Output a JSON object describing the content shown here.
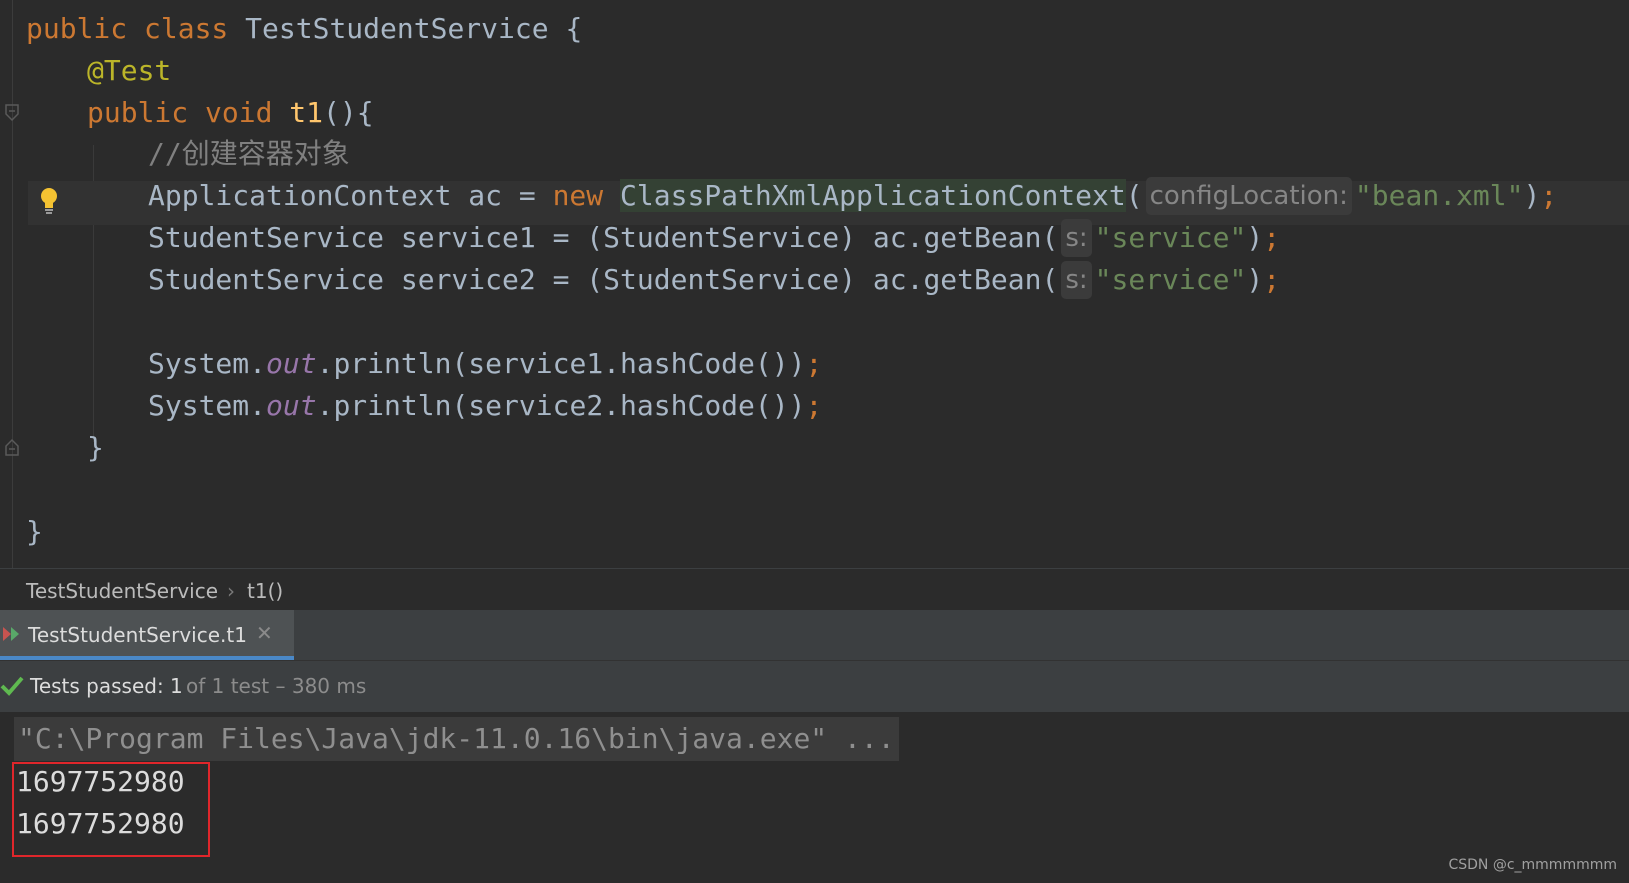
{
  "editor": {
    "class_decl": {
      "kw": "public class",
      "name": "TestStudentService",
      "brace": " {"
    },
    "annotation": "@Test",
    "method_decl": {
      "kw": "public void",
      "name": "t1",
      "rest": "(){"
    },
    "comment": "//创建容器对象",
    "line_ctx": {
      "pre": "ApplicationContext ac = ",
      "kw": "new",
      "cls": "ClassPathXmlApplicationContext",
      "open": "(",
      "hint": "configLocation:",
      "str": "\"bean.xml\"",
      "close": ")",
      "semi": ";"
    },
    "line_s1": {
      "pre": "StudentService service1 = (StudentService) ac.getBean(",
      "hint": "s:",
      "str": "\"service\"",
      "close": ")",
      "semi": ";"
    },
    "line_s2": {
      "pre": "StudentService service2 = (StudentService) ac.getBean(",
      "hint": "s:",
      "str": "\"service\"",
      "close": ")",
      "semi": ";"
    },
    "print1": {
      "pre": "System.",
      "field": "out",
      "rest": ".println(service1.hashCode())",
      "semi": ";"
    },
    "print2": {
      "pre": "System.",
      "field": "out",
      "rest": ".println(service2.hashCode())",
      "semi": ";"
    },
    "method_close": "}",
    "class_close": "}"
  },
  "breadcrumb": {
    "class": "TestStudentService",
    "sep": "›",
    "method": "t1()"
  },
  "run_tab": {
    "label": "TestStudentService.t1",
    "close": "✕"
  },
  "test_status": {
    "passed": "Tests passed: 1",
    "rest": "of 1 test – 380 ms"
  },
  "console": {
    "command": "\"C:\\Program Files\\Java\\jdk-11.0.16\\bin\\java.exe\" ...",
    "outputs": [
      "1697752980",
      "1697752980"
    ]
  },
  "watermark": "CSDN @c_mmmmmmm",
  "colors": {
    "keyword": "#cc7832",
    "string": "#6a8759",
    "annotation": "#bbb529",
    "method": "#ffc66d",
    "static_field": "#9876aa",
    "pass": "#5fb950",
    "highlight_box": "#e0262b",
    "tab_underline": "#4a88c7"
  }
}
